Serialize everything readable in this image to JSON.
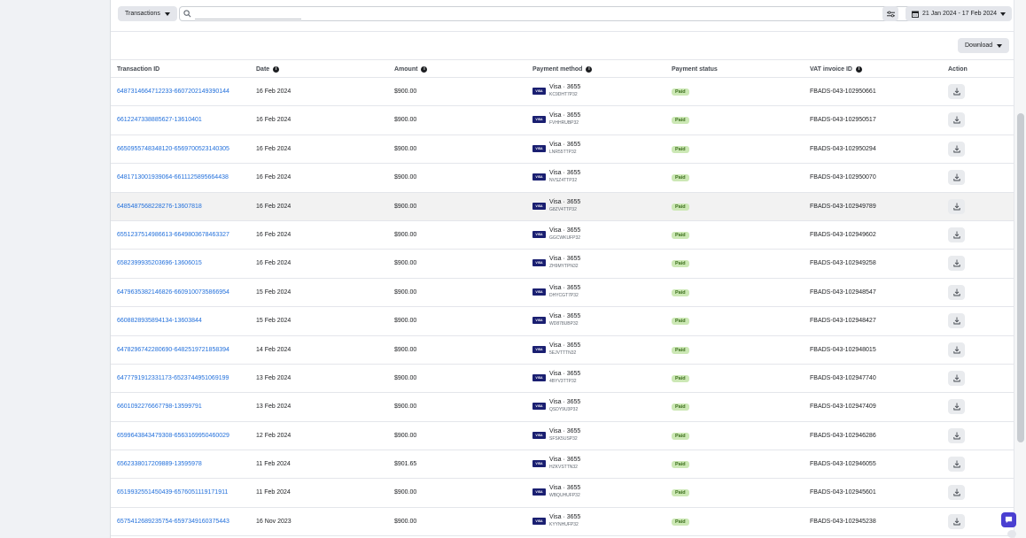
{
  "toolbar": {
    "filter_select": "Transactions",
    "search_placeholder": "",
    "date_range": "21 Jan 2024 - 17 Feb 2024"
  },
  "download_label": "Download",
  "columns": {
    "transaction_id": "Transaction ID",
    "date": "Date",
    "amount": "Amount",
    "payment_method": "Payment method",
    "payment_status": "Payment status",
    "vat_invoice_id": "VAT invoice ID",
    "action": "Action"
  },
  "rows": [
    {
      "id": "6487314664712233-6607202149390144",
      "date": "16 Feb 2024",
      "amount": "$900.00",
      "method": "Visa · 3655",
      "ref": "KC9DHT7P32",
      "status": "Paid",
      "vat": "FBADS-043-102950661"
    },
    {
      "id": "6612247338885627-13610401",
      "date": "16 Feb 2024",
      "amount": "$900.00",
      "method": "Visa · 3655",
      "ref": "FVHHRUBP32",
      "status": "Paid",
      "vat": "FBADS-043-102950517"
    },
    {
      "id": "6650955748348120-6569700523140305",
      "date": "16 Feb 2024",
      "amount": "$900.00",
      "method": "Visa · 3655",
      "ref": "LNR55TTP32",
      "status": "Paid",
      "vat": "FBADS-043-102950294"
    },
    {
      "id": "6481713001939064-6611125895664438",
      "date": "16 Feb 2024",
      "amount": "$900.00",
      "method": "Visa · 3655",
      "ref": "NVSZ4TTP32",
      "status": "Paid",
      "vat": "FBADS-043-102950070"
    },
    {
      "id": "6485487568228276-13607818",
      "date": "16 Feb 2024",
      "amount": "$900.00",
      "method": "Visa · 3655",
      "ref": "G8ZV4TTP32",
      "status": "Paid",
      "vat": "FBADS-043-102949789"
    },
    {
      "id": "6551237514986613-6649803678463327",
      "date": "16 Feb 2024",
      "amount": "$900.00",
      "method": "Visa · 3655",
      "ref": "GGCWKUFP32",
      "status": "Paid",
      "vat": "FBADS-043-102949602"
    },
    {
      "id": "6582399935203696-13606015",
      "date": "16 Feb 2024",
      "amount": "$900.00",
      "method": "Visa · 3655",
      "ref": "ZH9MYTPN32",
      "status": "Paid",
      "vat": "FBADS-043-102949258"
    },
    {
      "id": "6479635382146826-6609100735866954",
      "date": "15 Feb 2024",
      "amount": "$900.00",
      "method": "Visa · 3655",
      "ref": "DHYCGT7P32",
      "status": "Paid",
      "vat": "FBADS-043-102948547"
    },
    {
      "id": "6608828935894134-13603844",
      "date": "15 Feb 2024",
      "amount": "$900.00",
      "method": "Visa · 3655",
      "ref": "WD878UBP32",
      "status": "Paid",
      "vat": "FBADS-043-102948427"
    },
    {
      "id": "6478296742280690-6482519721858394",
      "date": "14 Feb 2024",
      "amount": "$900.00",
      "method": "Visa · 3655",
      "ref": "5EJVTTTN32",
      "status": "Paid",
      "vat": "FBADS-043-102948015"
    },
    {
      "id": "6477791912331173-6523744951069199",
      "date": "13 Feb 2024",
      "amount": "$900.00",
      "method": "Visa · 3655",
      "ref": "4BYV3TTP32",
      "status": "Paid",
      "vat": "FBADS-043-102947740"
    },
    {
      "id": "6601092276667798-13599791",
      "date": "13 Feb 2024",
      "amount": "$900.00",
      "method": "Visa · 3655",
      "ref": "QSDY9U3P32",
      "status": "Paid",
      "vat": "FBADS-043-102947409"
    },
    {
      "id": "6599643843479308-6563169950460029",
      "date": "12 Feb 2024",
      "amount": "$900.00",
      "method": "Visa · 3655",
      "ref": "SFSK5USP32",
      "status": "Paid",
      "vat": "FBADS-043-102946286"
    },
    {
      "id": "6562338017209889-13595978",
      "date": "11 Feb 2024",
      "amount": "$901.65",
      "method": "Visa · 3655",
      "ref": "HZKVSTTN32",
      "status": "Paid",
      "vat": "FBADS-043-102946055"
    },
    {
      "id": "6519932551450439-6576051119171911",
      "date": "11 Feb 2024",
      "amount": "$900.00",
      "method": "Visa · 3655",
      "ref": "WBQUHUFP32",
      "status": "Paid",
      "vat": "FBADS-043-102945601"
    },
    {
      "id": "6575412689235754-6597349160375443",
      "date": "16 Nov 2023",
      "amount": "$900.00",
      "method": "Visa · 3655",
      "ref": "KYYNHUFP32",
      "status": "Paid",
      "vat": "FBADS-043-102945238"
    }
  ],
  "card_brand": "VISA",
  "colors": {
    "link": "#216fdb",
    "paid_bg": "#cce8b5",
    "paid_text": "#3b6e1c",
    "visa_bg": "#1a1f71",
    "chat": "#4a3fd1"
  }
}
